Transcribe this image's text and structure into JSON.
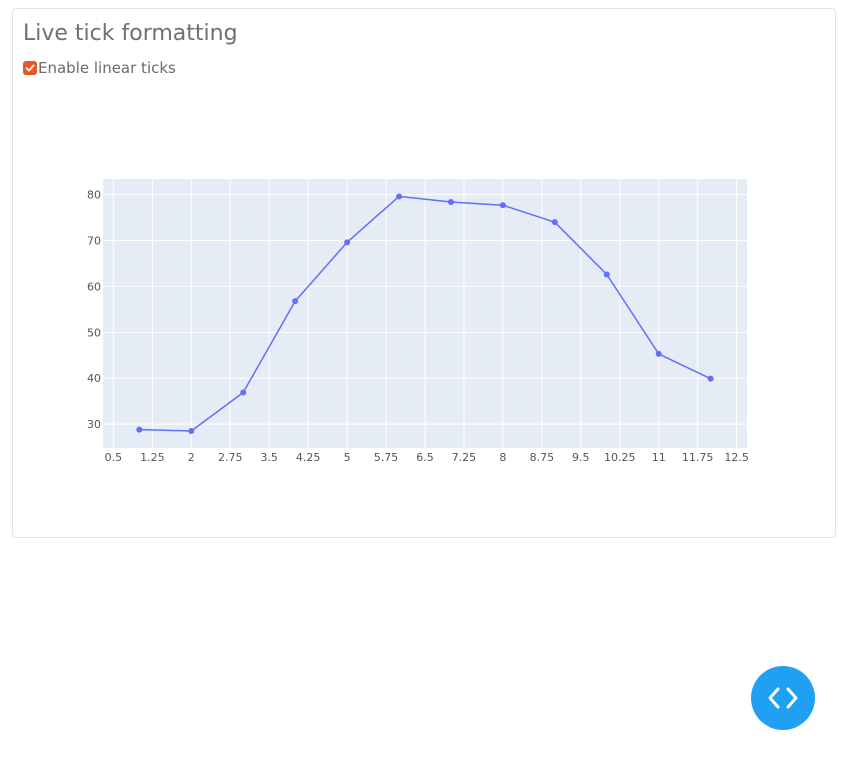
{
  "page": {
    "title": "Live tick formatting",
    "checkbox_label": "Enable linear ticks",
    "checkbox_checked": true
  },
  "colors": {
    "accent": "#e8572a",
    "line": "#636efa",
    "plot_bg": "#e5ecf6",
    "fab": "#1fa0f2"
  },
  "icons": {
    "checkbox": "check-icon",
    "fab": "code-icon"
  },
  "chart_data": {
    "type": "line",
    "x": [
      1,
      2,
      3,
      4,
      5,
      6,
      7,
      8,
      9,
      10,
      11,
      12
    ],
    "y": [
      28.8,
      28.5,
      36.9,
      56.8,
      69.6,
      79.6,
      78.4,
      77.7,
      74.0,
      62.6,
      45.3,
      39.9
    ],
    "xlim": [
      0.3,
      12.7
    ],
    "ylim": [
      24.8,
      83.4
    ],
    "x_tick_values": [
      0.5,
      1.25,
      2,
      2.75,
      3.5,
      4.25,
      5,
      5.75,
      6.5,
      7.25,
      8,
      8.75,
      9.5,
      10.25,
      11,
      11.75,
      12.5
    ],
    "x_tick_labels": [
      "0.5",
      "1.25",
      "2",
      "2.75",
      "3.5",
      "4.25",
      "5",
      "5.75",
      "6.5",
      "7.25",
      "8",
      "8.75",
      "9.5",
      "10.25",
      "11",
      "11.75",
      "12.5"
    ],
    "y_tick_values": [
      30,
      40,
      50,
      60,
      70,
      80
    ],
    "y_tick_labels": [
      "30",
      "40",
      "50",
      "60",
      "70",
      "80"
    ],
    "grid": true,
    "legend": "none",
    "title": "",
    "xlabel": "",
    "ylabel": ""
  }
}
